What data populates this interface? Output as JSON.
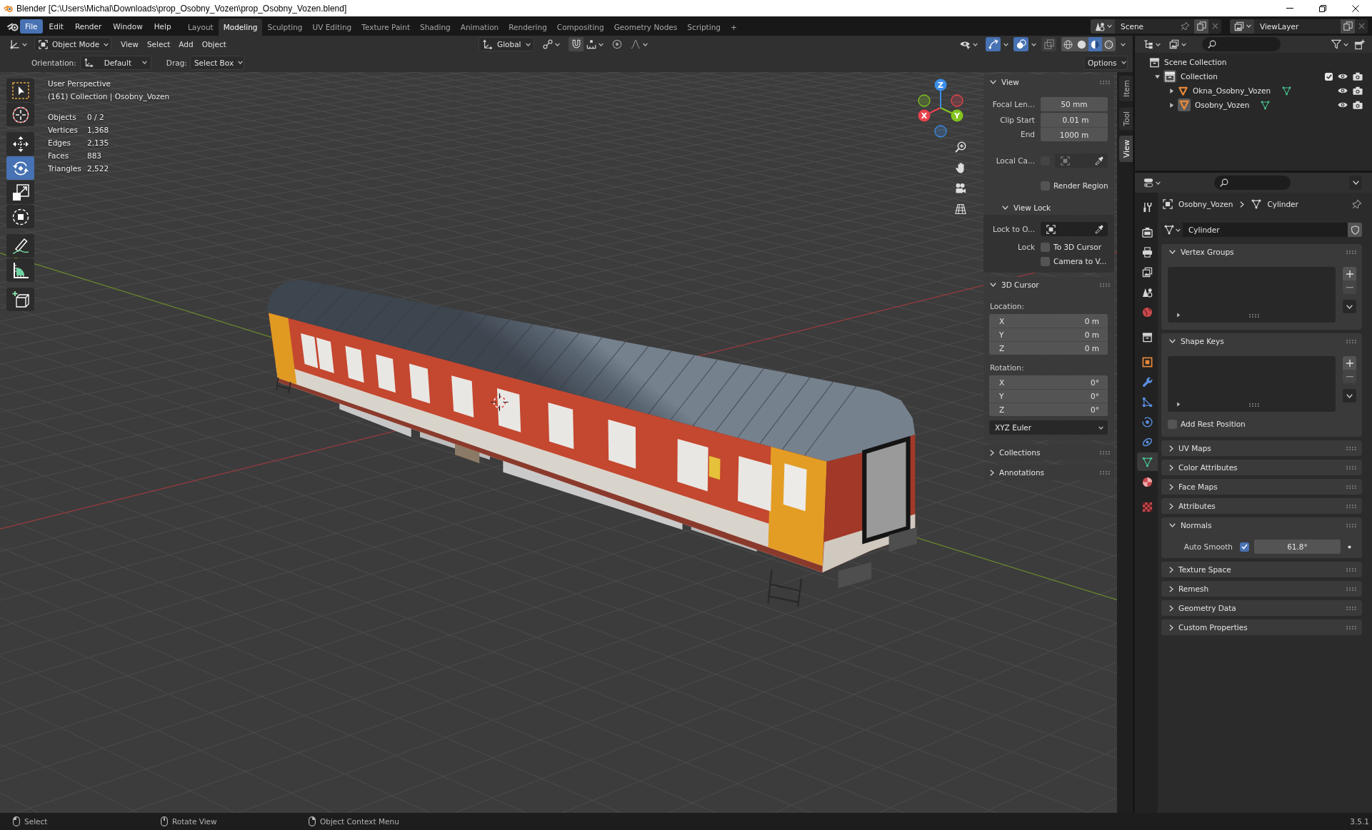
{
  "window": {
    "title": "Blender [C:\\Users\\Michal\\Downloads\\prop_Osobny_Vozen\\prop_Osobny_Vozen.blend]"
  },
  "menu_bar": [
    {
      "label": "File",
      "selected": true
    },
    {
      "label": "Edit",
      "selected": false
    },
    {
      "label": "Render",
      "selected": false
    },
    {
      "label": "Window",
      "selected": false
    },
    {
      "label": "Help",
      "selected": false
    }
  ],
  "workspaces": [
    {
      "label": "Layout",
      "selected": false
    },
    {
      "label": "Modeling",
      "selected": true
    },
    {
      "label": "Sculpting",
      "selected": false
    },
    {
      "label": "UV Editing",
      "selected": false
    },
    {
      "label": "Texture Paint",
      "selected": false
    },
    {
      "label": "Shading",
      "selected": false
    },
    {
      "label": "Animation",
      "selected": false
    },
    {
      "label": "Rendering",
      "selected": false
    },
    {
      "label": "Compositing",
      "selected": false
    },
    {
      "label": "Geometry Nodes",
      "selected": false
    },
    {
      "label": "Scripting",
      "selected": false
    }
  ],
  "add_workspace": "+",
  "scene": {
    "name": "Scene"
  },
  "view_layer": {
    "name": "ViewLayer"
  },
  "viewport_header": {
    "mode": "Object Mode",
    "menus": [
      "View",
      "Select",
      "Add",
      "Object"
    ],
    "transform_orientation": "Global",
    "toggles": [
      {
        "kind": "gizmo",
        "on": true
      },
      {
        "kind": "overlay",
        "on": true
      },
      {
        "kind": "xray",
        "on": false
      }
    ],
    "shading": [
      {
        "kind": "wireframe",
        "selected": false
      },
      {
        "kind": "solid",
        "selected": false
      },
      {
        "kind": "material",
        "selected": true
      },
      {
        "kind": "rendered",
        "selected": false
      }
    ]
  },
  "tool_settings": {
    "orientation_label": "Orientation:",
    "orientation": "Default",
    "drag_label": "Drag:",
    "drag": "Select Box",
    "options": "Options"
  },
  "toolbar": [
    {
      "kind": "select_box",
      "selected": false
    },
    {
      "kind": "cursor",
      "selected": false
    },
    {
      "kind": "move",
      "selected": false
    },
    {
      "kind": "rotate",
      "selected": true
    },
    {
      "kind": "scale",
      "selected": false
    },
    {
      "kind": "transform",
      "selected": false
    },
    {
      "kind": "annotate",
      "selected": false
    },
    {
      "kind": "measure",
      "selected": false
    },
    {
      "kind": "add_cube",
      "selected": false
    }
  ],
  "viewport_info": {
    "view": "User Perspective",
    "context": "(161) Collection | Osobny_Vozen",
    "stats": [
      {
        "label": "Objects",
        "value": "0 / 2"
      },
      {
        "label": "Vertices",
        "value": "1,368"
      },
      {
        "label": "Edges",
        "value": "2,135"
      },
      {
        "label": "Faces",
        "value": "883"
      },
      {
        "label": "Triangles",
        "value": "2,522"
      }
    ]
  },
  "gizmo_axes": [
    {
      "label": "X",
      "color": "#e8434e"
    },
    {
      "label": "Y",
      "color": "#83c31f"
    },
    {
      "label": "Z",
      "color": "#3b8ee8"
    }
  ],
  "sidebar": {
    "tabs": [
      {
        "label": "Item",
        "selected": false
      },
      {
        "label": "Tool",
        "selected": false
      },
      {
        "label": "View",
        "selected": true
      }
    ],
    "view_panel": {
      "title": "View",
      "expanded": true,
      "lens": [
        {
          "label": "Focal Len...",
          "value": "50 mm"
        },
        {
          "label": "Clip Start",
          "value": "0.01 m"
        },
        {
          "label": "End",
          "value": "1000 m"
        }
      ],
      "local_camera": {
        "label": "Local Ca...",
        "checked": false,
        "disabled": true
      },
      "render_region": {
        "label": "Render Region",
        "checked": false
      },
      "view_lock": {
        "title": "View Lock",
        "expanded": true,
        "lock_to": "Lock to O...",
        "lock_label": "Lock",
        "options": [
          {
            "label": "To 3D Cursor",
            "checked": false
          },
          {
            "label": "Camera to V...",
            "checked": false
          }
        ]
      }
    },
    "cursor_panel": {
      "title": "3D Cursor",
      "expanded": true,
      "location_label": "Location:",
      "location": [
        {
          "axis": "X",
          "value": "0 m"
        },
        {
          "axis": "Y",
          "value": "0 m"
        },
        {
          "axis": "Z",
          "value": "0 m"
        }
      ],
      "rotation_label": "Rotation:",
      "rotation": [
        {
          "axis": "X",
          "value": "0°"
        },
        {
          "axis": "Y",
          "value": "0°"
        },
        {
          "axis": "Z",
          "value": "0°"
        }
      ],
      "rotation_mode": "XYZ Euler"
    },
    "more_panels": [
      {
        "title": "Collections",
        "expanded": false
      },
      {
        "title": "Annotations",
        "expanded": false
      }
    ]
  },
  "outliner": {
    "tree": [
      {
        "label": "Scene Collection",
        "kind": "scene_collection",
        "children": [
          {
            "label": "Collection",
            "kind": "collection",
            "expanded": true,
            "included": true,
            "visible": true,
            "renderable": true,
            "children": [
              {
                "label": "Okna_Osobny_Vozen",
                "kind": "mesh",
                "expanded": false,
                "active": false,
                "visible": true,
                "renderable": true
              },
              {
                "label": "Osobny_Vozen",
                "kind": "mesh",
                "expanded": false,
                "active": true,
                "visible": true,
                "renderable": true
              }
            ]
          }
        ]
      }
    ]
  },
  "properties": {
    "tabs": [
      {
        "kind": "tool",
        "selected": false
      },
      {
        "kind": "render",
        "selected": false
      },
      {
        "kind": "output",
        "selected": false
      },
      {
        "kind": "view_layer",
        "selected": false
      },
      {
        "kind": "scene",
        "selected": false
      },
      {
        "kind": "world",
        "selected": false
      },
      {
        "kind": "collection",
        "selected": false
      },
      {
        "kind": "object",
        "selected": false
      },
      {
        "kind": "modifiers",
        "selected": false
      },
      {
        "kind": "particles",
        "selected": false
      },
      {
        "kind": "physics",
        "selected": false
      },
      {
        "kind": "constraints",
        "selected": false
      },
      {
        "kind": "data",
        "selected": true
      },
      {
        "kind": "material",
        "selected": false
      },
      {
        "kind": "texture",
        "selected": false
      }
    ],
    "breadcrumb": [
      {
        "kind": "object",
        "label": "Osobny_Vozen"
      },
      {
        "kind": "mesh",
        "label": "Cylinder"
      }
    ],
    "mesh_name": "Cylinder",
    "panels": [
      {
        "kind": "list",
        "title": "Vertex Groups",
        "expanded": true
      },
      {
        "kind": "list",
        "title": "Shape Keys",
        "expanded": true,
        "option": {
          "label": "Add Rest Position",
          "checked": false
        }
      },
      {
        "title": "UV Maps",
        "expanded": false
      },
      {
        "title": "Color Attributes",
        "expanded": false
      },
      {
        "title": "Face Maps",
        "expanded": false
      },
      {
        "title": "Attributes",
        "expanded": false
      },
      {
        "kind": "normals",
        "title": "Normals",
        "expanded": true,
        "option": {
          "label": "Auto Smooth",
          "checked": true
        },
        "angle": "61.8°"
      },
      {
        "title": "Texture Space",
        "expanded": false
      },
      {
        "title": "Remesh",
        "expanded": false
      },
      {
        "title": "Geometry Data",
        "expanded": false
      },
      {
        "title": "Custom Properties",
        "expanded": false
      }
    ]
  },
  "status_bar": {
    "hints": [
      {
        "kind": "left_click",
        "label": "Select"
      },
      {
        "kind": "middle_click",
        "label": "Rotate View"
      },
      {
        "kind": "right_click",
        "label": "Object Context Menu"
      }
    ],
    "version": "3.5.1"
  }
}
